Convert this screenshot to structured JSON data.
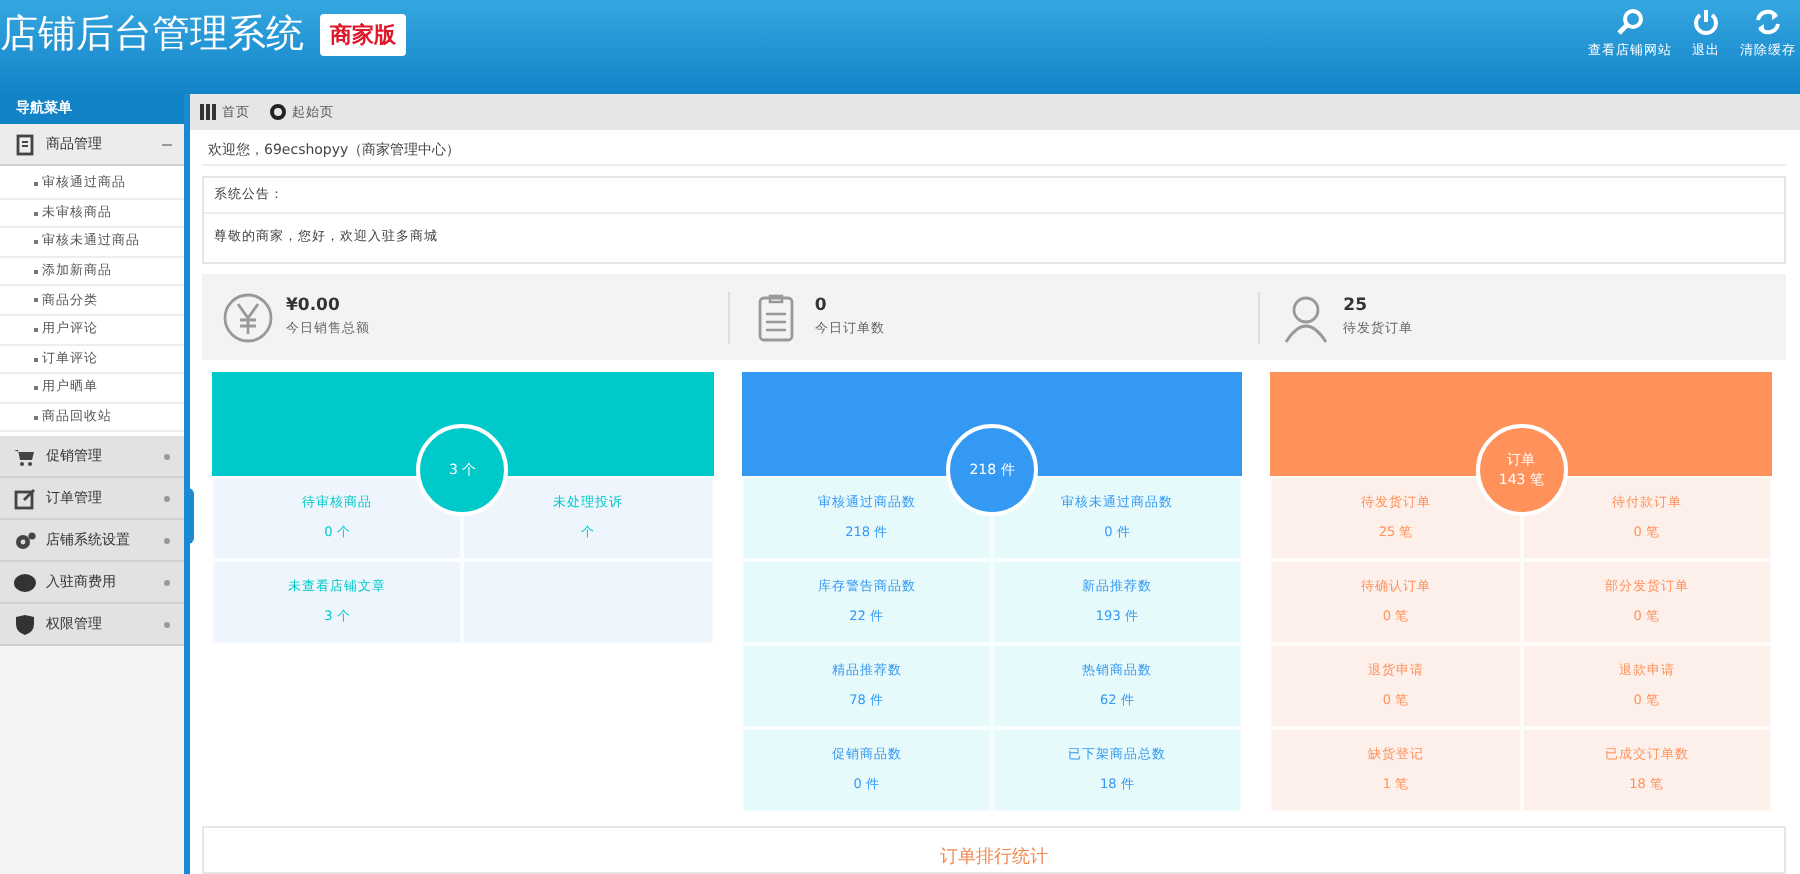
{
  "header": {
    "title": "店铺后台管理系统",
    "badge": "商家版",
    "actions": [
      {
        "kind": "search",
        "label": "查看店铺网站"
      },
      {
        "kind": "power",
        "label": "退出"
      },
      {
        "kind": "refresh",
        "label": "清除缓存"
      }
    ]
  },
  "sidebar": {
    "title": "导航菜单",
    "groups": [
      {
        "kind": "goods",
        "label": "商品管理",
        "expanded": true,
        "children": [
          {
            "label": "审核通过商品"
          },
          {
            "label": "未审核商品"
          },
          {
            "label": "审核未通过商品"
          },
          {
            "label": "添加新商品"
          },
          {
            "label": "商品分类"
          },
          {
            "label": "用户评论"
          },
          {
            "label": "订单评论"
          },
          {
            "label": "用户晒单"
          },
          {
            "label": "商品回收站"
          }
        ]
      },
      {
        "kind": "cart",
        "label": "促销管理",
        "expanded": false
      },
      {
        "kind": "order",
        "label": "订单管理",
        "expanded": false
      },
      {
        "kind": "gear",
        "label": "店铺系统设置",
        "expanded": false
      },
      {
        "kind": "coin",
        "label": "入驻商费用",
        "expanded": false
      },
      {
        "kind": "shield",
        "label": "权限管理",
        "expanded": false
      }
    ]
  },
  "breadcrumb": [
    {
      "kind": "grid",
      "label": "首页"
    },
    {
      "kind": "dot",
      "label": "起始页"
    }
  ],
  "welcome": "欢迎您，69ecshopyy（商家管理中心）",
  "notice": {
    "title": "系统公告：",
    "text": "尊敬的商家，您好，欢迎入驻多商城"
  },
  "stats": [
    {
      "kind": "yen",
      "value": "¥0.00",
      "label": "今日销售总额"
    },
    {
      "kind": "list",
      "value": "0",
      "label": "今日订单数"
    },
    {
      "kind": "person",
      "value": "25",
      "label": "待发货订单"
    }
  ],
  "cards": [
    {
      "color": "#00c9c9",
      "circle": [
        "3 个"
      ],
      "cells": [
        {
          "label": "待审核商品",
          "value": "0 个"
        },
        {
          "label": "未处理投诉",
          "value": "个"
        },
        {
          "label": "未查看店铺文章",
          "value": "3 个"
        },
        {}
      ]
    },
    {
      "color": "#3399f3",
      "circle": [
        "218 件"
      ],
      "cells": [
        {
          "label": "审核通过商品数",
          "value": "218 件"
        },
        {
          "label": "审核未通过商品数",
          "value": "0 件"
        },
        {
          "label": "库存警告商品数",
          "value": "22 件"
        },
        {
          "label": "新品推荐数",
          "value": "193 件"
        },
        {
          "label": "精品推荐数",
          "value": "78 件"
        },
        {
          "label": "热销商品数",
          "value": "62 件"
        },
        {
          "label": "促销商品数",
          "value": "0 件"
        },
        {
          "label": "已下架商品总数",
          "value": "18 件"
        }
      ]
    },
    {
      "color": "#ff915a",
      "circle": [
        "订单",
        "143 笔"
      ],
      "cells": [
        {
          "label": "待发货订单",
          "value": "25 笔"
        },
        {
          "label": "待付款订单",
          "value": "0 笔"
        },
        {
          "label": "待确认订单",
          "value": "0 笔"
        },
        {
          "label": "部分发货订单",
          "value": "0 笔"
        },
        {
          "label": "退货申请",
          "value": "0 笔"
        },
        {
          "label": "退款申请",
          "value": "0 笔"
        },
        {
          "label": "缺货登记",
          "value": "1 笔"
        },
        {
          "label": "已成交订单数",
          "value": "18 笔"
        }
      ]
    }
  ],
  "bottom_title": "订单排行统计"
}
